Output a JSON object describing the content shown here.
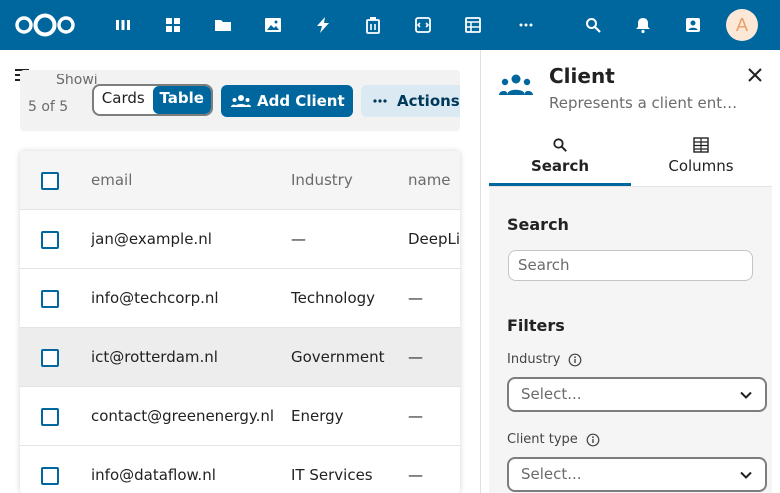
{
  "header": {
    "apps": [
      "dashboard-icon",
      "apps-icon",
      "files-icon",
      "photos-icon",
      "activity-icon",
      "deck-icon",
      "code-icon",
      "tables-icon",
      "more-apps-icon"
    ],
    "avatar_initial": "A"
  },
  "toolbar": {
    "showing_label": "Showing",
    "showing_count": "5 of 5",
    "view_cards": "Cards",
    "view_table": "Table",
    "add_client": "Add Client",
    "actions": "Actions"
  },
  "table": {
    "headers": {
      "email": "email",
      "industry": "Industry",
      "name": "name"
    },
    "rows": [
      {
        "email": "jan@example.nl",
        "industry": "—",
        "name": "DeepLi"
      },
      {
        "email": "info@techcorp.nl",
        "industry": "Technology",
        "name": "—"
      },
      {
        "email": "ict@rotterdam.nl",
        "industry": "Government",
        "name": "—"
      },
      {
        "email": "contact@greenenergy.nl",
        "industry": "Energy",
        "name": "—"
      },
      {
        "email": "info@dataflow.nl",
        "industry": "IT Services",
        "name": "—"
      }
    ]
  },
  "sidebar": {
    "title": "Client",
    "subtitle": "Represents a client ent…",
    "tabs": {
      "search": "Search",
      "columns": "Columns"
    },
    "search_heading": "Search",
    "search_placeholder": "Search",
    "filters_heading": "Filters",
    "industry_label": "Industry",
    "industry_placeholder": "Select...",
    "client_type_label": "Client type",
    "client_type_placeholder": "Select..."
  },
  "colors": {
    "primary": "#00679e",
    "header_bg": "#00679e",
    "secondary_bg": "#dbe9f3"
  }
}
